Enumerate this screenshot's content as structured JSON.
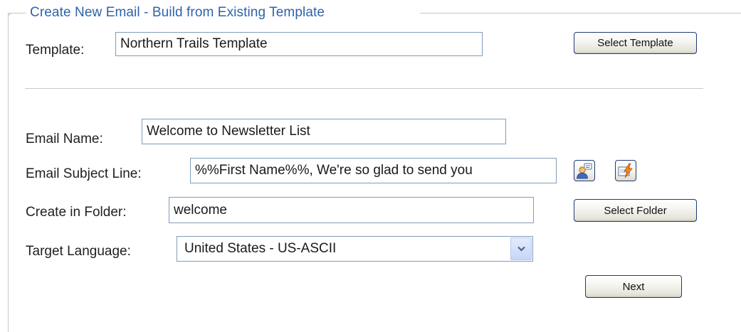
{
  "section": {
    "legend": "Create New Email - Build from Existing Template"
  },
  "template": {
    "label": "Template:",
    "value": "Northern Trails Template",
    "select_button": "Select Template"
  },
  "email_name": {
    "label": "Email Name:",
    "value": "Welcome to Newsletter List"
  },
  "subject": {
    "label": "Email Subject Line:",
    "value": "%%First Name%%, We're so glad to send you"
  },
  "folder": {
    "label": "Create in Folder:",
    "value": "welcome",
    "select_button": "Select Folder"
  },
  "language": {
    "label": "Target Language:",
    "selected": "United States - US-ASCII"
  },
  "actions": {
    "next": "Next"
  },
  "icons": {
    "personalization": "personalization-string-icon",
    "dynamic_content": "dynamic-content-icon"
  }
}
